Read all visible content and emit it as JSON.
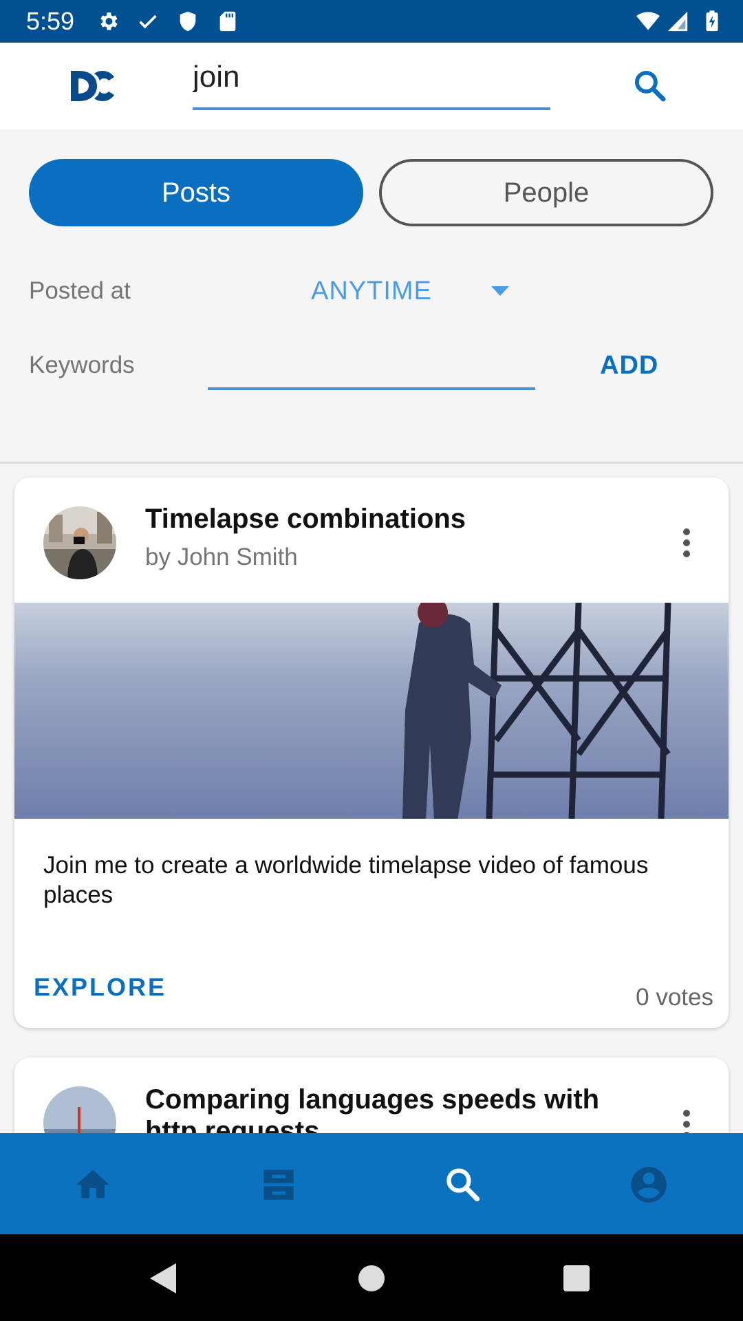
{
  "status_bar": {
    "time": "5:59",
    "icons": [
      "gear-icon",
      "check-icon",
      "shield-icon",
      "sd-card-icon",
      "wifi-icon",
      "signal-icon",
      "battery-icon"
    ]
  },
  "top_bar": {
    "logo": "DC",
    "search_query": "join"
  },
  "tabs": [
    {
      "label": "Posts",
      "selected": true
    },
    {
      "label": "People",
      "selected": false
    }
  ],
  "filters": {
    "posted_at_label": "Posted at",
    "posted_at_value": "ANYTIME",
    "keywords_label": "Keywords",
    "keywords_value": "",
    "add_label": "ADD"
  },
  "posts": [
    {
      "title": "Timelapse combinations",
      "author": "by John Smith",
      "description": "Join me to create a worldwide timelapse video of famous places",
      "action": "EXPLORE",
      "votes": "0 votes"
    },
    {
      "title": "Comparing languages speeds with http requests"
    }
  ],
  "bottom_nav": [
    "home-icon",
    "inbox-icon",
    "search-icon",
    "account-icon"
  ],
  "colors": {
    "primary": "#0a72bf",
    "status_bar": "#005092",
    "accent_light": "#4a9ce8"
  }
}
